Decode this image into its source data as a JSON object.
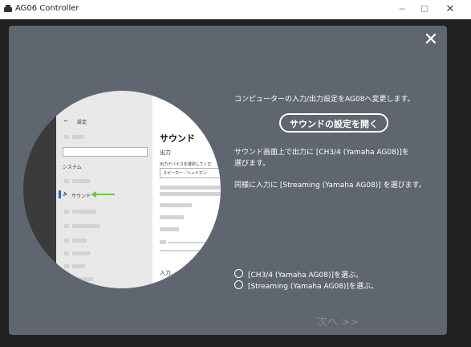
{
  "window": {
    "title": "AG06 Controller",
    "minimize": "─",
    "maximize": "☐",
    "close": "✕"
  },
  "dialog": {
    "close_label": "✕",
    "description": "コンピューターの入力/出力設定をAG08へ変更します。",
    "open_button_label": "サウンドの設定を開く",
    "instruction_line1": "サウンド画面上で出力に [CH3/4 (Yamaha AG08)]を",
    "instruction_line2": "選びます。",
    "instruction_input": "同様に入力に [Streaming (Yamaha AG08)] を選びます。",
    "checks": [
      {
        "label": "[CH3/4 (Yamaha AG08)]を選ぶ。",
        "checked": false
      },
      {
        "label": "[Streaming (Yamaha AG08)]を選ぶ。",
        "checked": false
      }
    ],
    "next_label": "次へ >>"
  },
  "illustration": {
    "back_arrow": "←",
    "settings_title": "設定",
    "system_label": "システム",
    "sound_nav_label": "サウンド",
    "speaker_icon": "🔈",
    "sound_heading": "サウンド",
    "output_label": "出力",
    "select_device_label": "出力デバイスを選択してくだ",
    "device_value": "スピーカー／ヘッドホン",
    "input_label": "入力",
    "arrow_color": "#7cc142"
  }
}
